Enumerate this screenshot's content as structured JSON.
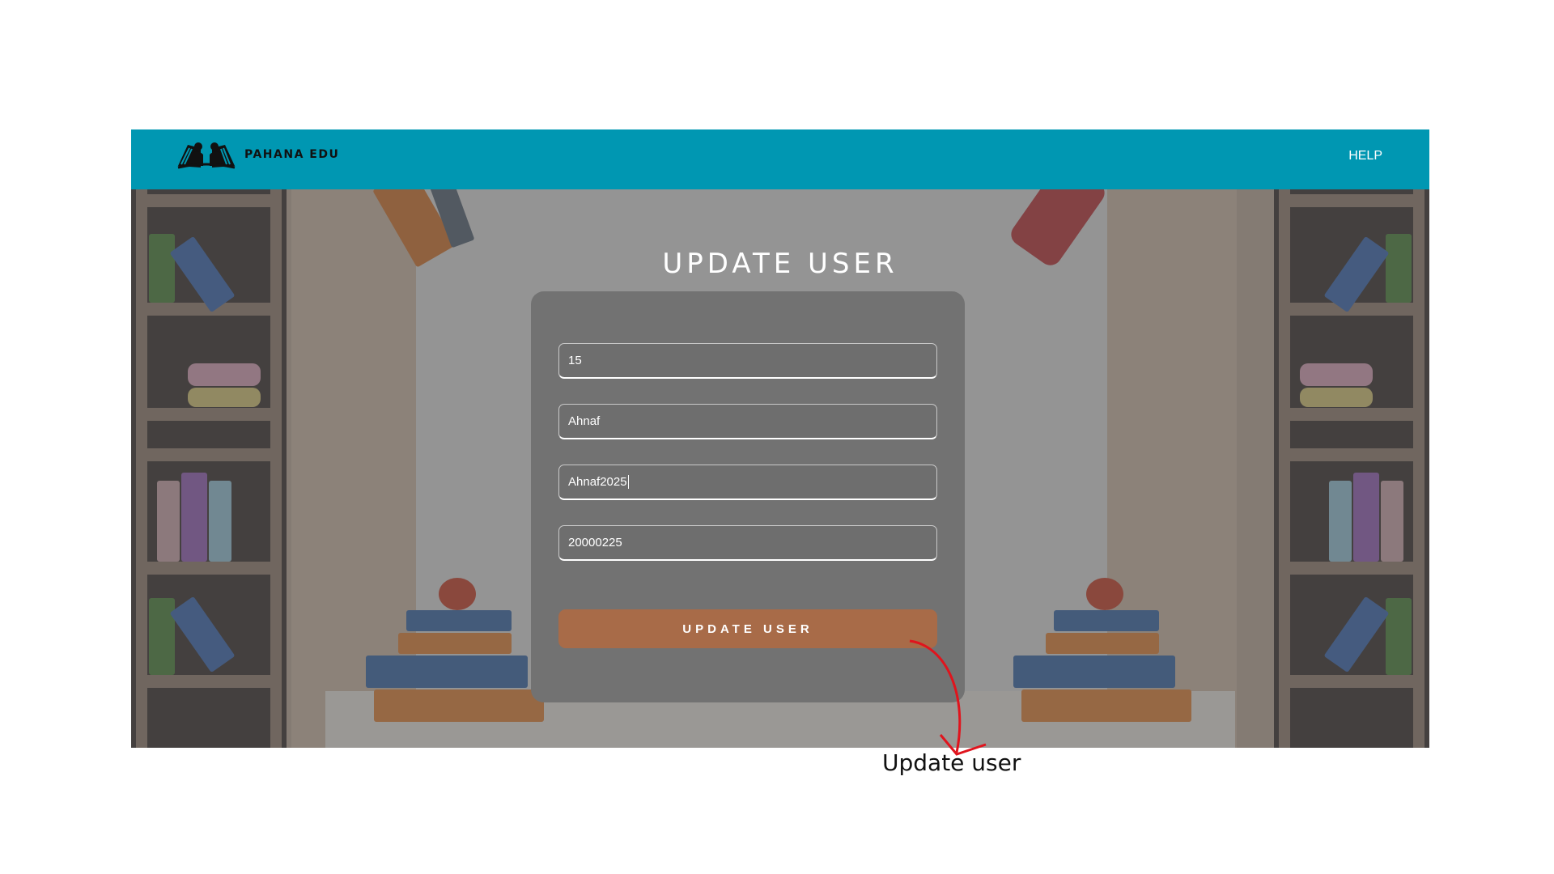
{
  "app": {
    "name": "PAHANA EDU"
  },
  "navbar": {
    "help_label": "HELP",
    "brand_color": "#0097b2"
  },
  "page": {
    "title": "UPDATE USER"
  },
  "form": {
    "fields": [
      {
        "value": "15"
      },
      {
        "value": "Ahnaf"
      },
      {
        "value": "Ahnaf2025"
      },
      {
        "value": "20000225"
      }
    ],
    "submit_label": "UPDATE USER",
    "submit_color": "#a86b48"
  },
  "annotation": {
    "label": "Update user",
    "arrow_color": "#e0141d"
  },
  "icons": {
    "logo": "open-book-readers-icon"
  }
}
